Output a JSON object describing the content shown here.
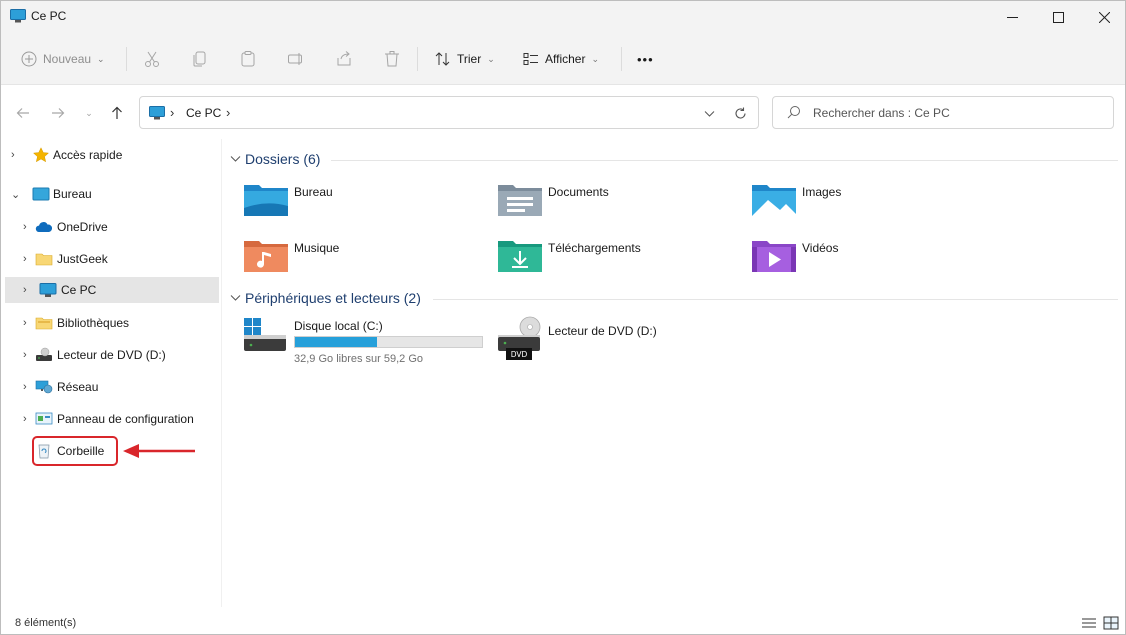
{
  "window": {
    "title": "Ce PC"
  },
  "toolbar": {
    "new_label": "Nouveau",
    "sort_label": "Trier",
    "view_label": "Afficher",
    "more_label": "•••"
  },
  "address": {
    "location": "Ce PC",
    "search_placeholder": "Rechercher dans : Ce PC"
  },
  "sidebar": {
    "items": [
      {
        "label": "Accès rapide",
        "icon": "star-icon"
      },
      {
        "label": "Bureau",
        "icon": "desktop-icon"
      },
      {
        "label": "OneDrive",
        "icon": "cloud-icon"
      },
      {
        "label": "JustGeek",
        "icon": "folder-icon"
      },
      {
        "label": "Ce PC",
        "icon": "monitor-icon"
      },
      {
        "label": "Bibliothèques",
        "icon": "library-icon"
      },
      {
        "label": "Lecteur de DVD (D:)",
        "icon": "dvd-drive-icon"
      },
      {
        "label": "Réseau",
        "icon": "network-icon"
      },
      {
        "label": "Panneau de configuration",
        "icon": "control-panel-icon"
      },
      {
        "label": "Corbeille",
        "icon": "recycle-bin-icon"
      }
    ]
  },
  "content": {
    "folders_title": "Dossiers (6)",
    "folders": [
      {
        "label": "Bureau",
        "icon": "desktop-folder-icon"
      },
      {
        "label": "Documents",
        "icon": "documents-folder-icon"
      },
      {
        "label": "Images",
        "icon": "pictures-folder-icon"
      },
      {
        "label": "Musique",
        "icon": "music-folder-icon"
      },
      {
        "label": "Téléchargements",
        "icon": "downloads-folder-icon"
      },
      {
        "label": "Vidéos",
        "icon": "videos-folder-icon"
      }
    ],
    "devices_title": "Périphériques et lecteurs (2)",
    "devices": [
      {
        "label": "Disque local (C:)",
        "free": "32,9 Go libres sur 59,2 Go",
        "used_fraction": 0.44,
        "icon": "hard-drive-icon"
      },
      {
        "label": "Lecteur de DVD (D:)",
        "icon": "dvd-drive-icon",
        "badge": "DVD"
      }
    ]
  },
  "status": {
    "count": "8 élément(s)"
  },
  "colors": {
    "accent": "#26a0da",
    "highlight": "#d9262b"
  }
}
